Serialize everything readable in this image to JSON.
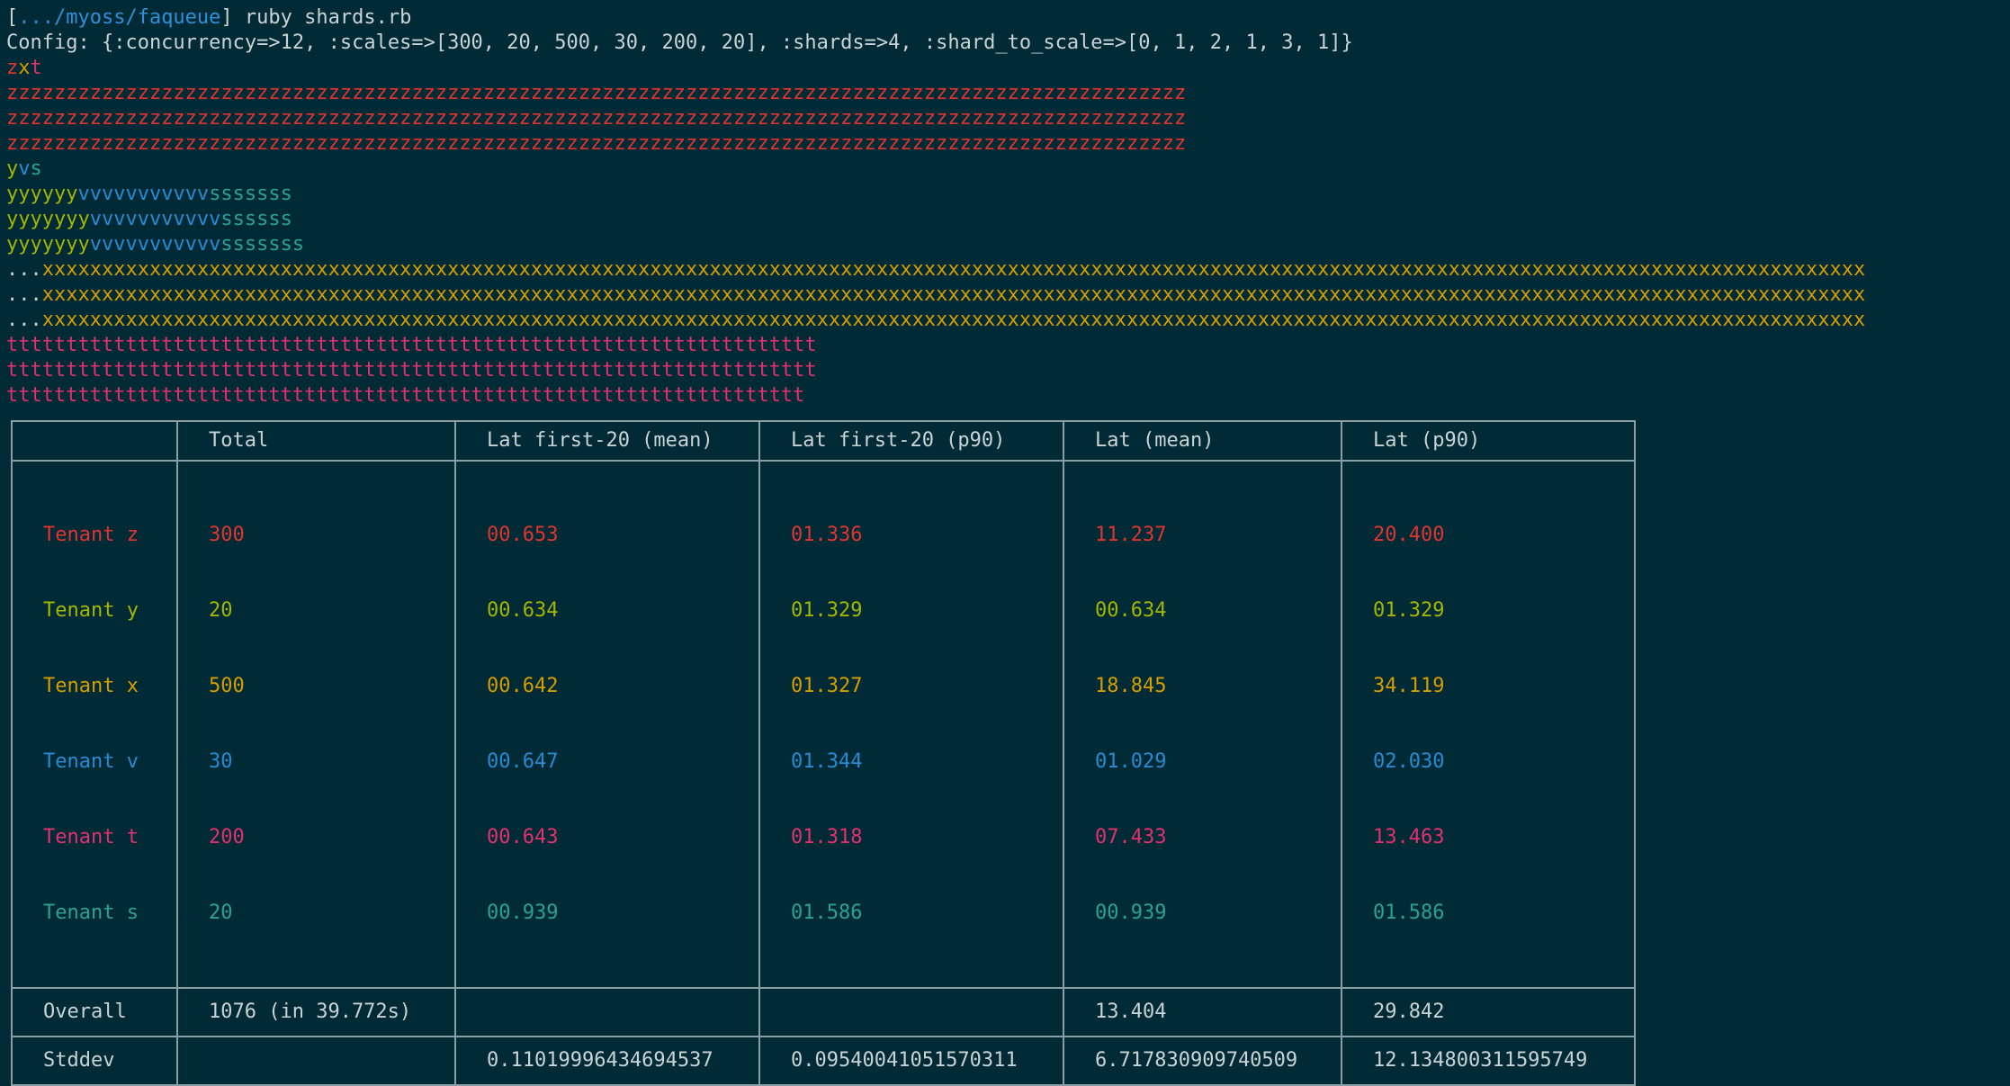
{
  "prompt": {
    "open_bracket": "[",
    "path": ".../myoss/faqueue",
    "close_bracket": "]",
    "command": " ruby shards.rb"
  },
  "config_line": "Config: {:concurrency=>12, :scales=>[300, 20, 500, 30, 200, 20], :shards=>4, :shard_to_scale=>[0, 1, 2, 1, 3, 1]}",
  "output": {
    "zxt": {
      "z": "z",
      "x": "x",
      "t": "t"
    },
    "z_rows": [
      "zzzzzzzzzzzzzzzzzzzzzzzzzzzzzzzzzzzzzzzzzzzzzzzzzzzzzzzzzzzzzzzzzzzzzzzzzzzzzzzzzzzzzzzzzzzzzzzzzzz",
      "zzzzzzzzzzzzzzzzzzzzzzzzzzzzzzzzzzzzzzzzzzzzzzzzzzzzzzzzzzzzzzzzzzzzzzzzzzzzzzzzzzzzzzzzzzzzzzzzzzz",
      "zzzzzzzzzzzzzzzzzzzzzzzzzzzzzzzzzzzzzzzzzzzzzzzzzzzzzzzzzzzzzzzzzzzzzzzzzzzzzzzzzzzzzzzzzzzzzzzzzzz"
    ],
    "yvs": {
      "y": "y",
      "v": "v",
      "s": "s"
    },
    "yvs_rows": [
      {
        "y": "yyyyyy",
        "v": "vvvvvvvvvvv",
        "s": "sssssss"
      },
      {
        "y": "yyyyyyy",
        "v": "vvvvvvvvvvv",
        "s": "ssssss"
      },
      {
        "y": "yyyyyyy",
        "v": "vvvvvvvvvvv",
        "s": "sssssss"
      }
    ],
    "x_rows": [
      {
        "dots": "...",
        "x": "xxxxxxxxxxxxxxxxxxxxxxxxxxxxxxxxxxxxxxxxxxxxxxxxxxxxxxxxxxxxxxxxxxxxxxxxxxxxxxxxxxxxxxxxxxxxxxxxxxxxxxxxxxxxxxxxxxxxxxxxxxxxxxxxxxxxxxxxxxxxxxxxxxxxxxxxx"
      },
      {
        "dots": "...",
        "x": "xxxxxxxxxxxxxxxxxxxxxxxxxxxxxxxxxxxxxxxxxxxxxxxxxxxxxxxxxxxxxxxxxxxxxxxxxxxxxxxxxxxxxxxxxxxxxxxxxxxxxxxxxxxxxxxxxxxxxxxxxxxxxxxxxxxxxxxxxxxxxxxxxxxxxxxxx"
      },
      {
        "dots": "...",
        "x": "xxxxxxxxxxxxxxxxxxxxxxxxxxxxxxxxxxxxxxxxxxxxxxxxxxxxxxxxxxxxxxxxxxxxxxxxxxxxxxxxxxxxxxxxxxxxxxxxxxxxxxxxxxxxxxxxxxxxxxxxxxxxxxxxxxxxxxxxxxxxxxxxxxxxxxxxx"
      }
    ],
    "t_rows": [
      "tttttttttttttttttttttttttttttttttttttttttttttttttttttttttttttttttttt",
      "tttttttttttttttttttttttttttttttttttttttttttttttttttttttttttttttttttt",
      "ttttttttttttttttttttttttttttttttttttttttttttttttttttttttttttttttttt"
    ]
  },
  "table": {
    "headers": [
      "",
      "Total",
      "Lat first-20 (mean)",
      "Lat first-20 (p90)",
      "Lat (mean)",
      "Lat (p90)"
    ],
    "tenants": [
      {
        "label": "Tenant z",
        "total": "300",
        "f20_mean": "00.653",
        "f20_p90": "01.336",
        "mean": "11.237",
        "p90": "20.400"
      },
      {
        "label": "Tenant y",
        "total": "20",
        "f20_mean": "00.634",
        "f20_p90": "01.329",
        "mean": "00.634",
        "p90": "01.329"
      },
      {
        "label": "Tenant x",
        "total": "500",
        "f20_mean": "00.642",
        "f20_p90": "01.327",
        "mean": "18.845",
        "p90": "34.119"
      },
      {
        "label": "Tenant v",
        "total": "30",
        "f20_mean": "00.647",
        "f20_p90": "01.344",
        "mean": "01.029",
        "p90": "02.030"
      },
      {
        "label": "Tenant t",
        "total": "200",
        "f20_mean": "00.643",
        "f20_p90": "01.318",
        "mean": "07.433",
        "p90": "13.463"
      },
      {
        "label": "Tenant s",
        "total": "20",
        "f20_mean": "00.939",
        "f20_p90": "01.586",
        "mean": "00.939",
        "p90": "01.586"
      }
    ],
    "overall": {
      "label": "Overall",
      "total": "1076 (in 39.772s)",
      "f20_mean": "",
      "f20_p90": "",
      "mean": "13.404",
      "p90": "29.842"
    },
    "stddev": {
      "label": "Stddev",
      "total": "",
      "f20_mean": "0.11019996434694537",
      "f20_p90": "0.09540041051570311",
      "mean": "6.717830909740509",
      "p90": "12.134800311595749"
    }
  },
  "colors": {
    "background": "#002b36",
    "text": "#c9d3d5",
    "tenant_z": "#e0342f",
    "tenant_y": "#a4b600",
    "tenant_x": "#d69d00",
    "tenant_v": "#268bd2",
    "tenant_t": "#e2306f",
    "tenant_s": "#2aa198",
    "border": "#8a9ea3"
  }
}
